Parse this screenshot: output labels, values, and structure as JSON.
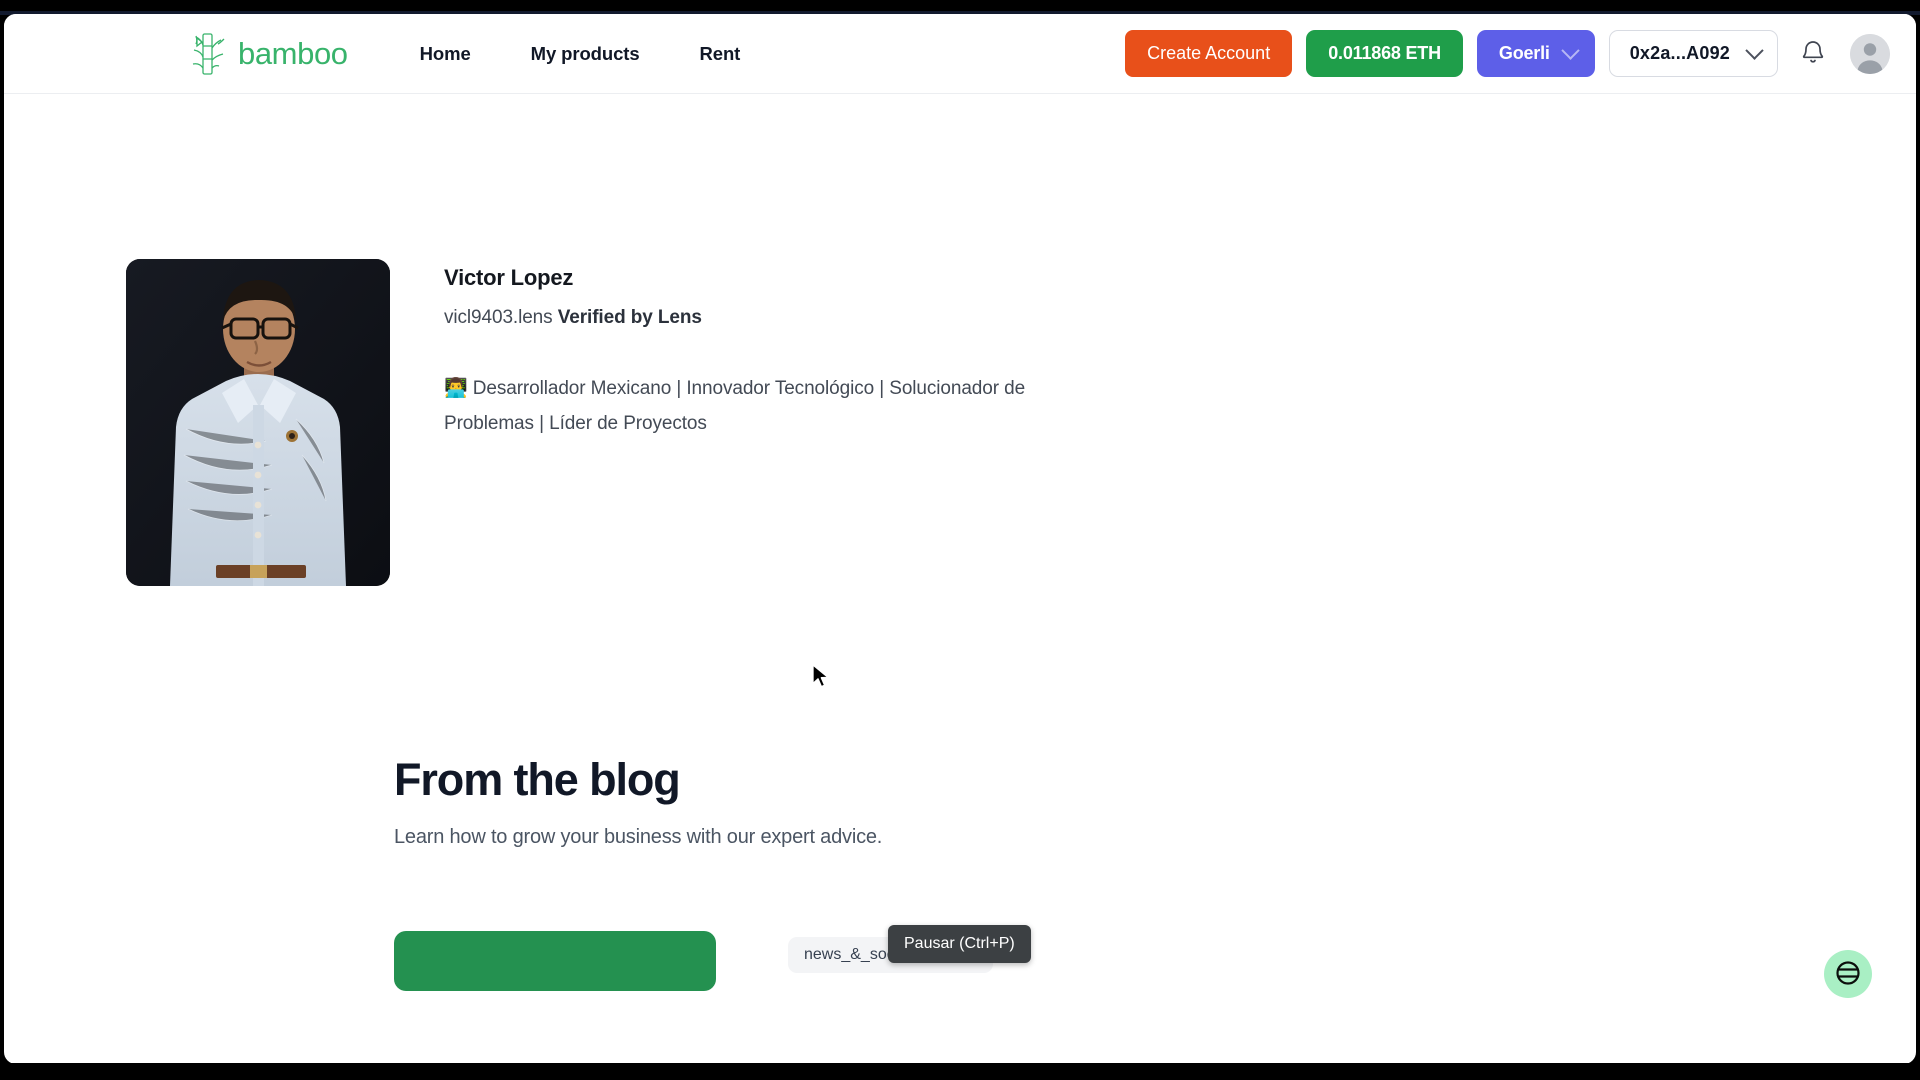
{
  "brand": {
    "name": "bamboo",
    "logo_icon": "bamboo-stalk-icon",
    "color": "#38b36b"
  },
  "nav": {
    "items": [
      {
        "label": "Home"
      },
      {
        "label": "My products"
      },
      {
        "label": "Rent"
      }
    ]
  },
  "header_actions": {
    "create_account_label": "Create Account",
    "create_account_color": "#e8501a",
    "balance_label": "0.011868 ETH",
    "balance_color": "#1f9e4a",
    "network_label": "Goerli",
    "network_color": "#5d5fe8",
    "address_label": "0x2a...A092",
    "notifications_icon": "bell-icon",
    "avatar_icon": "user-avatar-icon"
  },
  "profile": {
    "photo_alt": "profile-photo",
    "name": "Victor Lopez",
    "handle": "vicl9403.lens",
    "verified_label": "Verified by Lens",
    "bio": "👨‍💻 Desarrollador Mexicano | Innovador Tecnológico | Solucionador de Problemas | Líder de Proyectos"
  },
  "blog": {
    "title": "From the blog",
    "subtitle": "Learn how to grow your business with our expert advice.",
    "cta_color": "#249150",
    "cta_label": "",
    "tag_label": "news_&_social_concern"
  },
  "overlays": {
    "tooltip_text": "Pausar (Ctrl+P)",
    "fab_icon": "lens-logo-icon",
    "fab_color": "#a9efc4",
    "cursor_icon": "arrow-cursor-icon"
  }
}
